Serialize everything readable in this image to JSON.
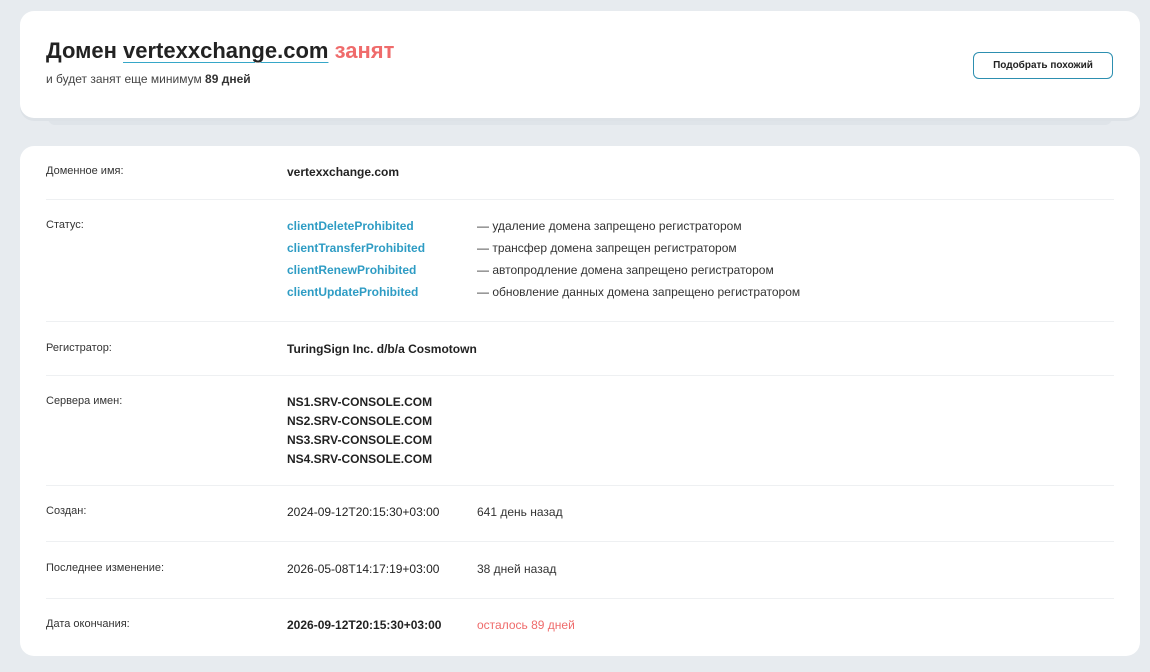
{
  "header": {
    "title_prefix": "Домен",
    "domain": "vertexxchange.com",
    "status_word": "занят",
    "subtitle_prefix": "и будет занят еще минимум",
    "subtitle_days": "89 дней",
    "similar_button": "Подобрать похожий"
  },
  "info": {
    "domain_name": {
      "label": "Доменное имя:",
      "value": "vertexxchange.com"
    },
    "status": {
      "label": "Статус:",
      "items": [
        {
          "code": "clientDeleteProhibited",
          "desc": "— удаление домена запрещено регистратором"
        },
        {
          "code": "clientTransferProhibited",
          "desc": "— трансфер домена запрещен регистратором"
        },
        {
          "code": "clientRenewProhibited",
          "desc": "— автопродление домена запрещено регистратором"
        },
        {
          "code": "clientUpdateProhibited",
          "desc": "— обновление данных домена запрещено регистратором"
        }
      ]
    },
    "registrar": {
      "label": "Регистратор:",
      "value": "TuringSign Inc. d/b/a Cosmotown"
    },
    "nameservers": {
      "label": "Сервера имен:",
      "items": [
        "NS1.SRV-CONSOLE.COM",
        "NS2.SRV-CONSOLE.COM",
        "NS3.SRV-CONSOLE.COM",
        "NS4.SRV-CONSOLE.COM"
      ]
    },
    "created": {
      "label": "Создан:",
      "value": "2024-09-12T20:15:30+03:00",
      "ago": "641 день назад"
    },
    "updated": {
      "label": "Последнее изменение:",
      "value": "2026-05-08T14:17:19+03:00",
      "ago": "38 дней назад"
    },
    "expires": {
      "label": "Дата окончания:",
      "value": "2026-09-12T20:15:30+03:00",
      "ago": "осталось 89 дней"
    }
  },
  "colors": {
    "accent": "#2e9cc4",
    "busy": "#ef6b6b",
    "background": "#e7ebef"
  }
}
